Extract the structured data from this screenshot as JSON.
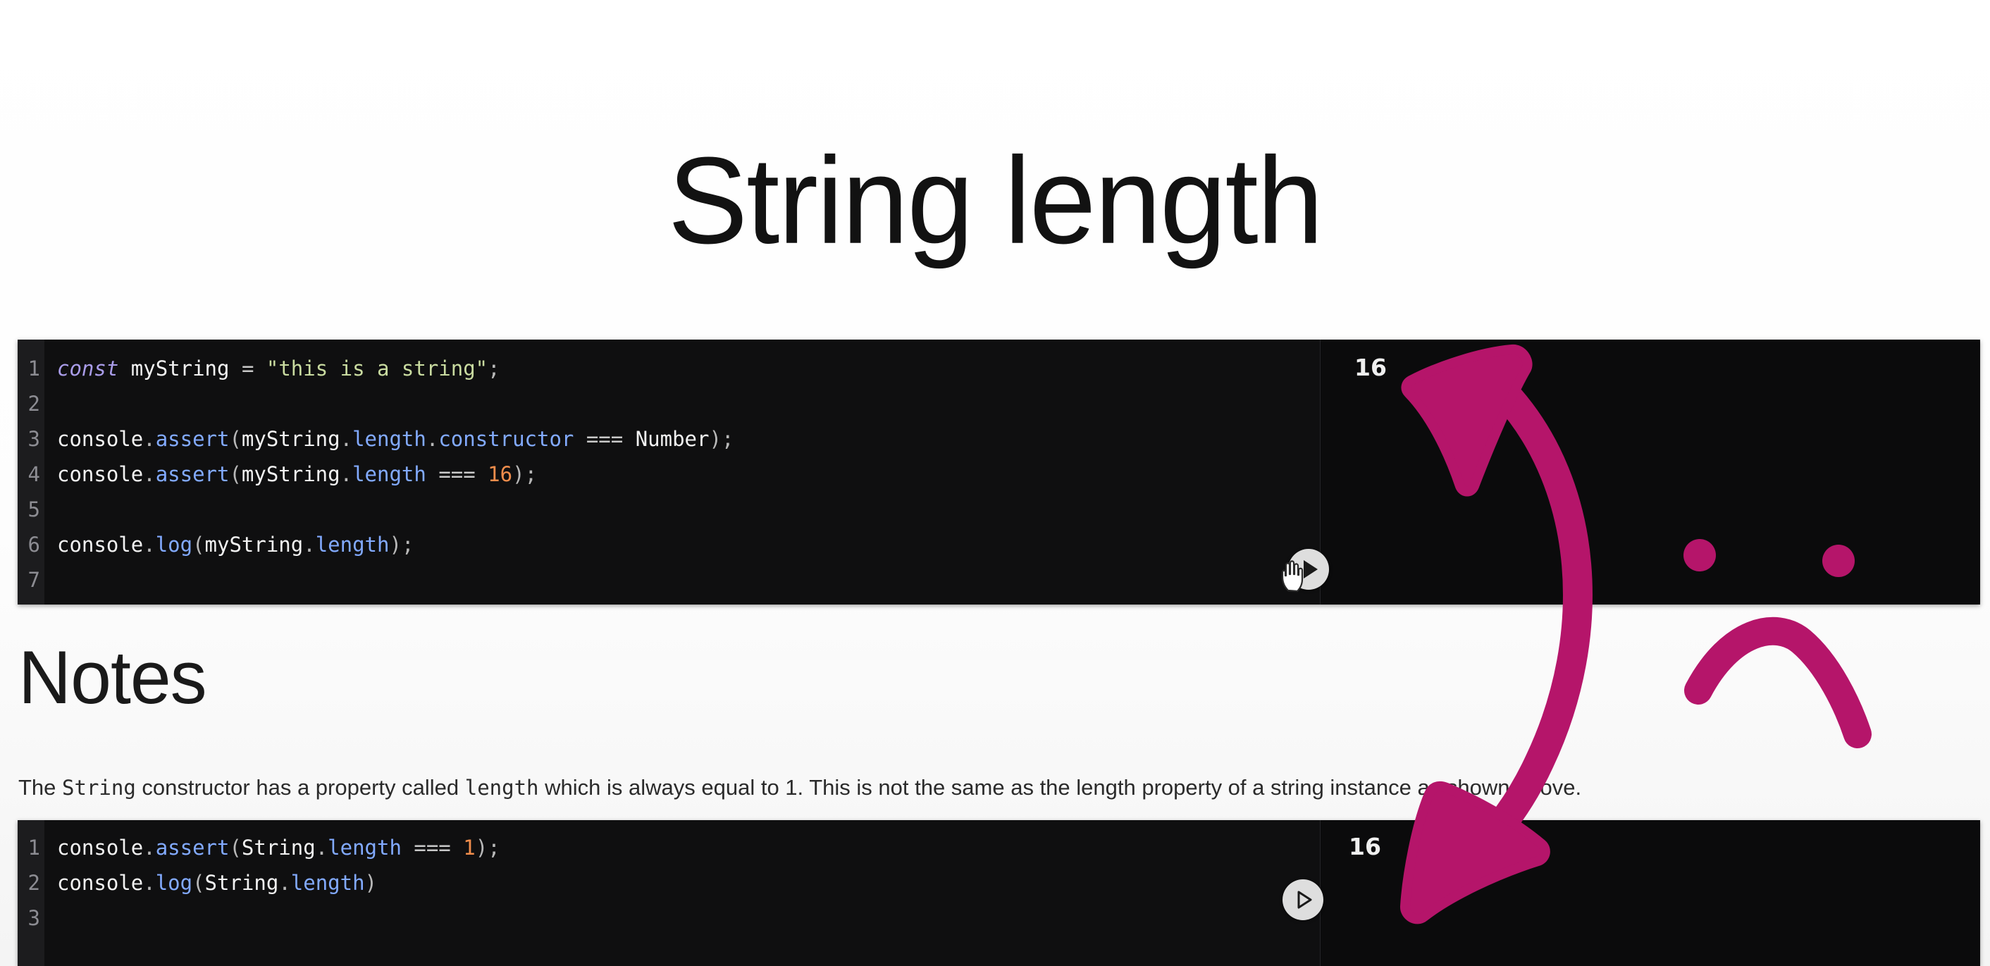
{
  "page": {
    "title": "String length",
    "background_color": "#ffffff"
  },
  "code_block_top": {
    "line_numbers": [
      "1",
      "2",
      "3",
      "4",
      "5",
      "6",
      "7"
    ],
    "lines": [
      [
        {
          "t": "const",
          "c": "kw"
        },
        {
          "t": " ",
          "c": "plain"
        },
        {
          "t": "myString",
          "c": "var"
        },
        {
          "t": " ",
          "c": "plain"
        },
        {
          "t": "=",
          "c": "op"
        },
        {
          "t": " ",
          "c": "plain"
        },
        {
          "t": "\"this is a string\"",
          "c": "str"
        },
        {
          "t": ";",
          "c": "punct"
        }
      ],
      [],
      [
        {
          "t": "console",
          "c": "plain"
        },
        {
          "t": ".",
          "c": "punct"
        },
        {
          "t": "assert",
          "c": "fn"
        },
        {
          "t": "(",
          "c": "punct"
        },
        {
          "t": "myString",
          "c": "plain"
        },
        {
          "t": ".",
          "c": "punct"
        },
        {
          "t": "length",
          "c": "prop"
        },
        {
          "t": ".",
          "c": "punct"
        },
        {
          "t": "constructor",
          "c": "prop"
        },
        {
          "t": " ",
          "c": "plain"
        },
        {
          "t": "===",
          "c": "op"
        },
        {
          "t": " ",
          "c": "plain"
        },
        {
          "t": "Number",
          "c": "plain"
        },
        {
          "t": ")",
          "c": "punct"
        },
        {
          "t": ";",
          "c": "punct"
        }
      ],
      [
        {
          "t": "console",
          "c": "plain"
        },
        {
          "t": ".",
          "c": "punct"
        },
        {
          "t": "assert",
          "c": "fn"
        },
        {
          "t": "(",
          "c": "punct"
        },
        {
          "t": "myString",
          "c": "plain"
        },
        {
          "t": ".",
          "c": "punct"
        },
        {
          "t": "length",
          "c": "prop"
        },
        {
          "t": " ",
          "c": "plain"
        },
        {
          "t": "===",
          "c": "op"
        },
        {
          "t": " ",
          "c": "plain"
        },
        {
          "t": "16",
          "c": "num"
        },
        {
          "t": ")",
          "c": "punct"
        },
        {
          "t": ";",
          "c": "punct"
        }
      ],
      [],
      [
        {
          "t": "console",
          "c": "plain"
        },
        {
          "t": ".",
          "c": "punct"
        },
        {
          "t": "log",
          "c": "fn"
        },
        {
          "t": "(",
          "c": "punct"
        },
        {
          "t": "myString",
          "c": "plain"
        },
        {
          "t": ".",
          "c": "punct"
        },
        {
          "t": "length",
          "c": "prop"
        },
        {
          "t": ")",
          "c": "punct"
        },
        {
          "t": ";",
          "c": "punct"
        }
      ],
      []
    ],
    "output_value": "16",
    "run_button_label": "run-code"
  },
  "notes": {
    "heading": "Notes",
    "body_parts": [
      {
        "t": "The ",
        "code": false
      },
      {
        "t": "String",
        "code": true
      },
      {
        "t": " constructor has a property called ",
        "code": false
      },
      {
        "t": "length",
        "code": true
      },
      {
        "t": " which is always equal to 1. This is not the same as the length property of a string instance as shown above.",
        "code": false
      }
    ]
  },
  "code_block_bottom": {
    "line_numbers": [
      "1",
      "2",
      "3"
    ],
    "lines": [
      [
        {
          "t": "console",
          "c": "plain"
        },
        {
          "t": ".",
          "c": "punct"
        },
        {
          "t": "assert",
          "c": "fn"
        },
        {
          "t": "(",
          "c": "punct"
        },
        {
          "t": "String",
          "c": "plain"
        },
        {
          "t": ".",
          "c": "punct"
        },
        {
          "t": "length",
          "c": "prop"
        },
        {
          "t": " ",
          "c": "plain"
        },
        {
          "t": "===",
          "c": "op"
        },
        {
          "t": " ",
          "c": "plain"
        },
        {
          "t": "1",
          "c": "num"
        },
        {
          "t": ")",
          "c": "punct"
        },
        {
          "t": ";",
          "c": "punct"
        }
      ],
      [
        {
          "t": "console",
          "c": "plain"
        },
        {
          "t": ".",
          "c": "punct"
        },
        {
          "t": "log",
          "c": "fn"
        },
        {
          "t": "(",
          "c": "punct"
        },
        {
          "t": "String",
          "c": "plain"
        },
        {
          "t": ".",
          "c": "punct"
        },
        {
          "t": "length",
          "c": "prop"
        },
        {
          "t": ")",
          "c": "punct"
        }
      ],
      []
    ],
    "output_value": "16",
    "run_button_label": "run-code"
  },
  "annotation": {
    "color": "#b5156a",
    "shapes": [
      "double-headed-curved-arrow",
      "sad-face"
    ]
  },
  "syntax_colors": {
    "keyword": "#a99ce8",
    "string": "#c9dba0",
    "property": "#82aaff",
    "function": "#82aaff",
    "number": "#f08d4c",
    "plain": "#f2f2f2",
    "editor_background": "#0d0d0d",
    "gutter_background": "#1c1c1e"
  }
}
